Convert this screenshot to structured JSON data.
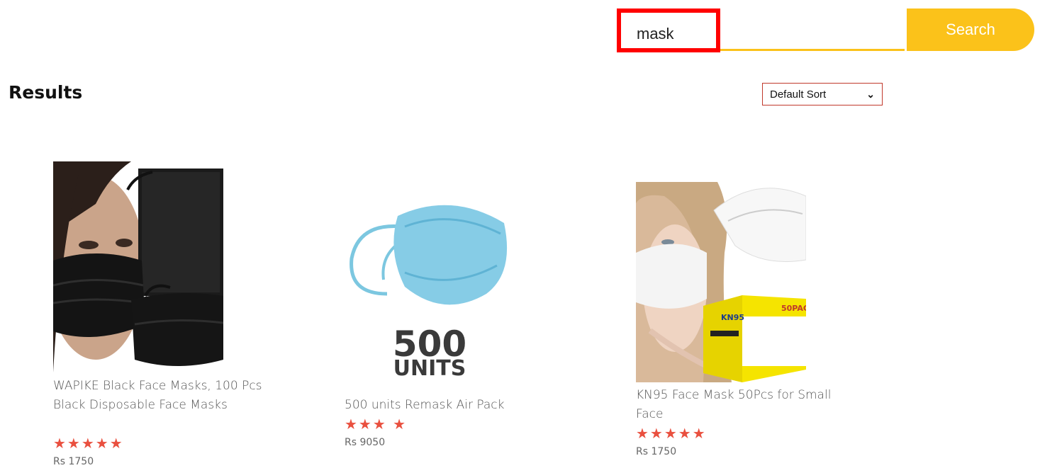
{
  "search": {
    "value": "mask",
    "button_label": "Search"
  },
  "results": {
    "title": "Results",
    "sort": {
      "selected": "Default Sort"
    }
  },
  "products": [
    {
      "name": "WAPIKE Black Face Masks, 100 Pcs Black Disposable Face Masks",
      "rating": 5,
      "stars": "★★★★★",
      "price": "Rs 1750",
      "image": "black-face-masks-image"
    },
    {
      "name": "500 units Remask Air Pack",
      "rating": 3,
      "stars": "★★★ ★",
      "price": "Rs 9050",
      "image": "blue-mask-500-units-image",
      "image_text": {
        "line1": "500",
        "line2": "UNITS"
      }
    },
    {
      "name": "KN95 Face Mask 50Pcs for Small Face",
      "rating": 5,
      "stars": "★★★★★",
      "price": "Rs 1750",
      "image": "kn95-mask-image",
      "image_text": {
        "box_label": "KN95",
        "pack_label": "50PAC"
      }
    }
  ],
  "colors": {
    "accent": "#fbc21a",
    "highlight": "#ff0000",
    "star": "#e9503f"
  }
}
